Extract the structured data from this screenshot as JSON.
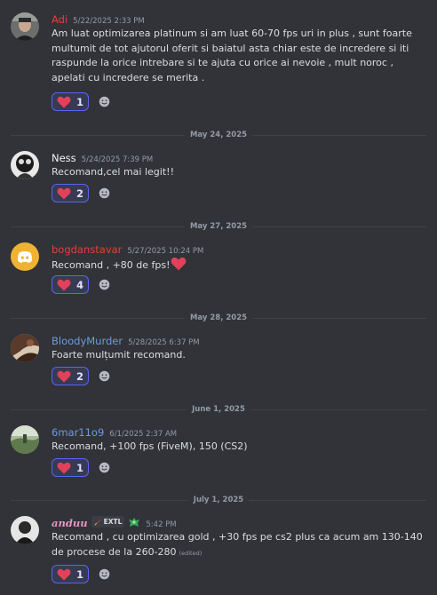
{
  "colors": {
    "background": "#313338",
    "reaction_bg": "#373a53",
    "reaction_border": "#5865f2",
    "name_red": "#e3403a",
    "name_white": "#f2f3f5",
    "name_blue": "#6c9be0",
    "name_pink": "#e894c6"
  },
  "messages": [
    {
      "username": "Adi",
      "timestamp": "5/22/2025 2:33 PM",
      "text": "Am luat optimizarea platinum si am luat 60-70 fps uri in plus , sunt foarte multumit de tot ajutorul oferit si baiatul asta chiar este de incredere si iti raspunde la orice intrebare si te ajuta cu orice ai nevoie , mult noroc , apelati cu incredere se merita .",
      "reaction": {
        "emoji": "heart",
        "count": "1"
      }
    },
    {
      "divider": "May 24, 2025",
      "username": "Ness",
      "timestamp": "5/24/2025 7:39 PM",
      "text": "Recomand,cel mai legit!!",
      "reaction": {
        "emoji": "heart",
        "count": "2"
      }
    },
    {
      "divider": "May 27, 2025",
      "username": "bogdanstavar",
      "timestamp": "5/27/2025 10:24 PM",
      "text": "Recomand , +80 de fps!",
      "reaction": {
        "emoji": "heart",
        "count": "4"
      }
    },
    {
      "divider": "May 28, 2025",
      "username": "BloodyMurder",
      "timestamp": "5/28/2025 6:37 PM",
      "text": "Foarte mulțumit recomand.",
      "reaction": {
        "emoji": "heart",
        "count": "2"
      }
    },
    {
      "divider": "June 1, 2025",
      "username": "6mar11o9",
      "timestamp": "6/1/2025 2:37 AM",
      "text": "Recomand, +100 fps (FiveM), 150 (CS2)",
      "reaction": {
        "emoji": "heart",
        "count": "1"
      }
    },
    {
      "divider": "July 1, 2025",
      "username": "anduu",
      "guild_tag": "EXTL",
      "timestamp": "5:42 PM",
      "text": "Recomand , cu optimizarea gold , +30 fps pe cs2 plus ca acum am 130-140 de procese de la 260-280",
      "edited": "(edited)",
      "reaction": {
        "emoji": "heart",
        "count": "1"
      }
    }
  ]
}
